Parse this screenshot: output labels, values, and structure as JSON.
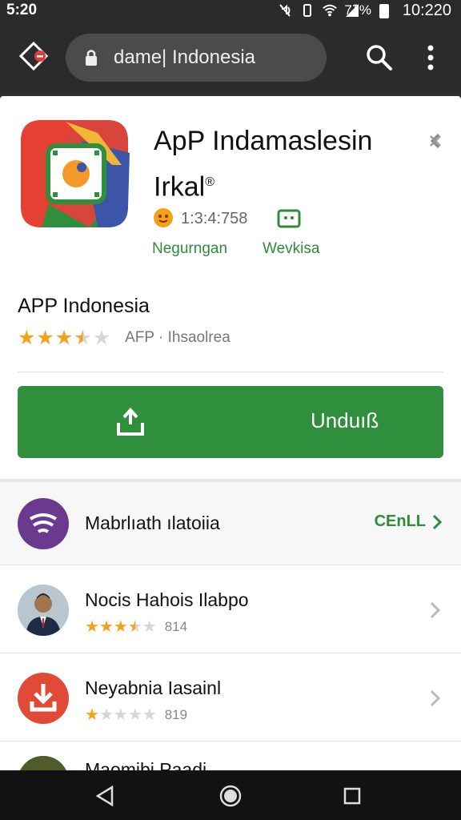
{
  "status_bar": {
    "left_time": "5:20",
    "battery_percent": "7‽%",
    "clock": "10:220"
  },
  "url_bar": {
    "url_text": "dame| Indonesia",
    "icons": [
      "home-icon",
      "lock-icon",
      "search-icon",
      "more-vert-icon"
    ]
  },
  "app_header": {
    "title": "ApP Indamaslesin Irkal",
    "title_mark": "®",
    "count_text": "1:3:4:758",
    "labels": [
      "Negurngan",
      "Wevkisa"
    ],
    "icons": [
      "rating-badge-icon",
      "chat-icon",
      "close-icon"
    ]
  },
  "app_detail": {
    "name": "APP Indonesia",
    "rating": 3.5,
    "rating_sub": "AFP · Ihsaolrea",
    "install_label": "Unduıß",
    "colors": {
      "install": "#2f8f3c",
      "accent_green": "#2e8b3e",
      "star": "#f4a21a"
    }
  },
  "list": {
    "section": {
      "title": "Mabrlıath ılatoiia",
      "more_label": "CEnLL"
    },
    "items": [
      {
        "title": "Nocis Hahois Ilabpo",
        "rating": 3.5,
        "price": "814"
      },
      {
        "title": "Neyabnia Iasainl",
        "rating": 1,
        "price": "819"
      },
      {
        "title": "Maomibi Paadi"
      }
    ]
  },
  "nav_bar": {
    "icons": [
      "back-icon",
      "home-circle-icon",
      "recents-icon"
    ]
  }
}
